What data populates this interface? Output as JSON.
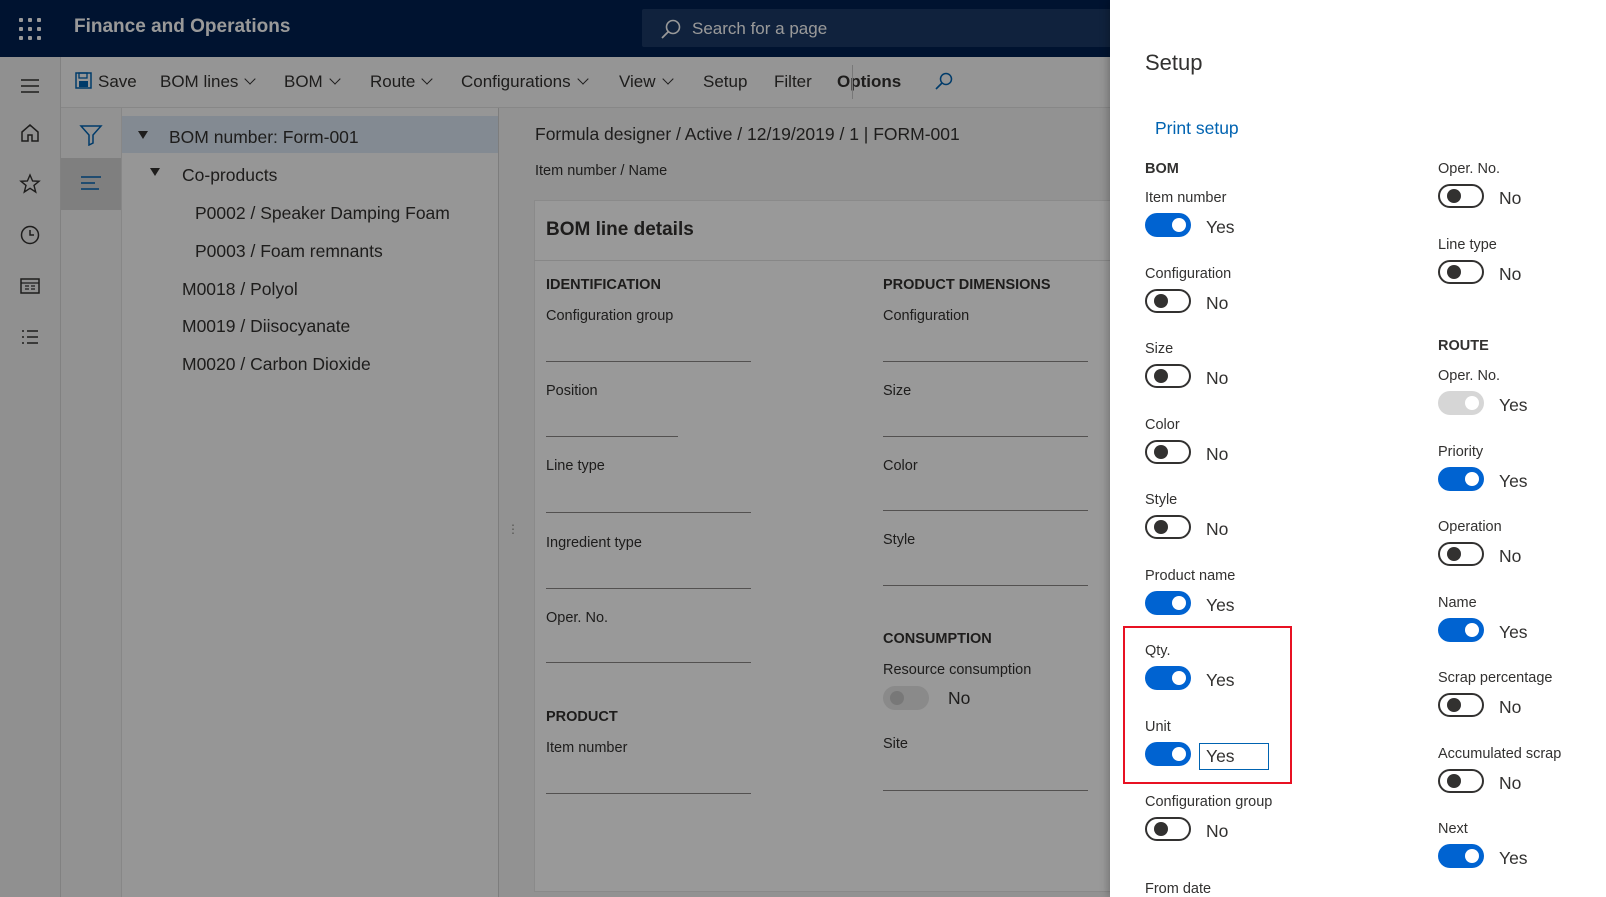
{
  "header": {
    "app_title": "Finance and Operations",
    "search_placeholder": "Search for a page"
  },
  "actions": {
    "save": "Save",
    "bom_lines": "BOM lines",
    "bom": "BOM",
    "route": "Route",
    "configurations": "Configurations",
    "view": "View",
    "setup": "Setup",
    "filter": "Filter",
    "options": "Options"
  },
  "tree": {
    "root": "BOM number: Form-001",
    "coproducts": "Co-products",
    "items": [
      "P0002 / Speaker Damping Foam",
      "P0003 / Foam remnants"
    ],
    "lines": [
      "M0018 / Polyol",
      "M0019 / Diisocyanate",
      "M0020 / Carbon Dioxide"
    ]
  },
  "main": {
    "breadcrumb": "Formula designer / Active / 12/19/2019 / 1   |   FORM-001",
    "item_name": "Item number / Name",
    "card_title": "BOM line details",
    "identification": "IDENTIFICATION",
    "config_group": "Configuration group",
    "position": "Position",
    "line_type": "Line type",
    "ingredient_type": "Ingredient type",
    "oper_no": "Oper. No.",
    "product": "PRODUCT",
    "item_number": "Item number",
    "product_dimensions": "PRODUCT DIMENSIONS",
    "configuration": "Configuration",
    "size": "Size",
    "color": "Color",
    "style": "Style",
    "consumption": "CONSUMPTION",
    "resource_consumption": "Resource consumption",
    "resource_consumption_value": "No",
    "site": "Site"
  },
  "panel": {
    "title": "Setup",
    "print_setup": "Print setup",
    "bom_header": "BOM",
    "route_header": "ROUTE",
    "bom_toggles": [
      {
        "label": "Item number",
        "value": "Yes",
        "state": "on"
      },
      {
        "label": "Configuration",
        "value": "No",
        "state": "off"
      },
      {
        "label": "Size",
        "value": "No",
        "state": "off"
      },
      {
        "label": "Color",
        "value": "No",
        "state": "off"
      },
      {
        "label": "Style",
        "value": "No",
        "state": "off"
      },
      {
        "label": "Product name",
        "value": "Yes",
        "state": "on"
      },
      {
        "label": "Qty.",
        "value": "Yes",
        "state": "on"
      },
      {
        "label": "Unit",
        "value": "Yes",
        "state": "on"
      },
      {
        "label": "Configuration group",
        "value": "No",
        "state": "off"
      }
    ],
    "from_date": "From date",
    "right_toggles": [
      {
        "label": "Oper. No.",
        "value": "No",
        "state": "off"
      },
      {
        "label": "Line type",
        "value": "No",
        "state": "off"
      }
    ],
    "route_toggles": [
      {
        "label": "Oper. No.",
        "value": "Yes",
        "state": "disabled"
      },
      {
        "label": "Priority",
        "value": "Yes",
        "state": "on"
      },
      {
        "label": "Operation",
        "value": "No",
        "state": "off"
      },
      {
        "label": "Name",
        "value": "Yes",
        "state": "on"
      },
      {
        "label": "Scrap percentage",
        "value": "No",
        "state": "off"
      },
      {
        "label": "Accumulated scrap",
        "value": "No",
        "state": "off"
      },
      {
        "label": "Next",
        "value": "Yes",
        "state": "on"
      }
    ]
  },
  "colors": {
    "header": "#002050",
    "accent": "#0063d1",
    "link": "#0063b1",
    "highlight": "#e81123"
  }
}
